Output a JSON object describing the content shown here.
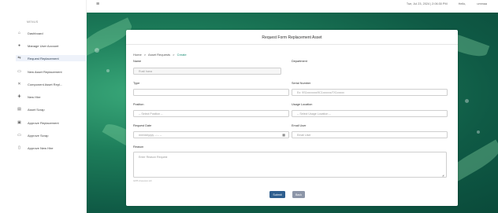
{
  "topbar": {
    "datetime": "Tue, Jul 23, 2024 | 2:06:30 PM",
    "greeting": "Hello,",
    "username": "ummaa"
  },
  "sidebar": {
    "menu_title": "MENUS",
    "items": [
      {
        "label": "Dashboard",
        "icon": "home-icon",
        "glyph": "⌂"
      },
      {
        "label": "Manage User Account",
        "icon": "user-icon",
        "glyph": "●"
      },
      {
        "label": "Request Replacement",
        "icon": "swap-icon",
        "glyph": "⇆",
        "active": true
      },
      {
        "label": "New Asset Replacement",
        "icon": "document-icon",
        "glyph": "▭"
      },
      {
        "label": "Component Asset Repl...",
        "icon": "tools-icon",
        "glyph": "✕"
      },
      {
        "label": "New Hire",
        "icon": "add-user-icon",
        "glyph": "✚"
      },
      {
        "label": "Asset Scrap",
        "icon": "trash-icon",
        "glyph": "▤"
      },
      {
        "label": "Approve Replacement",
        "icon": "approve-icon",
        "glyph": "▣"
      },
      {
        "label": "Approve Scrap",
        "icon": "folder-icon",
        "glyph": "▭"
      },
      {
        "label": "Approve New Hire",
        "icon": "document-icon",
        "glyph": "▯"
      }
    ]
  },
  "form": {
    "title": "Request Form Replacement Asset",
    "breadcrumb": [
      "Home",
      "Asset Requests",
      "Create"
    ],
    "name_label": "Name",
    "name_value": "Rusli hana",
    "department_label": "Department",
    "type_label": "Type",
    "serial_label": "Serial Number",
    "serial_placeholder": "Ex: 9S1xxxxxxx/9C1xxxxxx/7X1xxxxx",
    "position_label": "Position",
    "position_placeholder": "-- Select Position --",
    "usage_label": "Usage Location",
    "usage_placeholder": "-- Select Usage Location --",
    "request_date_label": "Request Date",
    "request_date_placeholder": "mm/dd/yyyy --:-- --",
    "email_label": "Email User",
    "email_placeholder": "Email User",
    "reason_label": "Reason",
    "reason_placeholder": "Enter Reason Request",
    "char_hint": "0/255 characters left",
    "submit_label": "Submit",
    "back_label": "Back"
  },
  "colors": {
    "accent": "#2f5f8f",
    "breadcrumb_active": "#1e8f76",
    "back_button": "#8d96a8",
    "background_green": "#1d7d5a"
  }
}
